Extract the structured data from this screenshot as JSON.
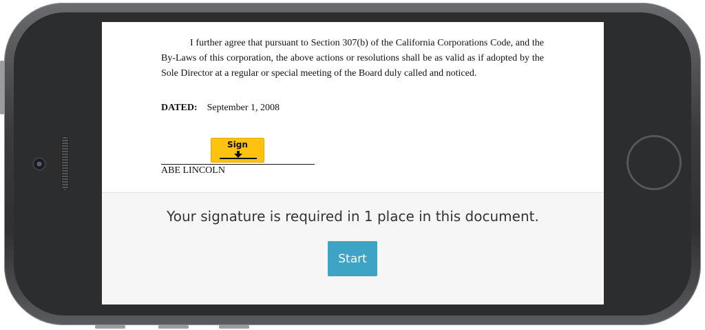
{
  "document": {
    "paragraph": "I further agree that pursuant to Section 307(b) of the California Corporations Code, and the By-Laws of this corporation, the above actions or resolutions shall be as valid as if adopted by the Sole Director at a regular or special meeting of the Board duly called and noticed.",
    "dated_label": "DATED:",
    "dated_value": "September 1, 2008",
    "sign_label": "Sign",
    "sign_icon": "down-arrow-icon",
    "signer_name": "ABE LINCOLN"
  },
  "panel": {
    "message": "Your signature is required in 1 place in this document.",
    "start_label": "Start"
  },
  "colors": {
    "sign_button": "#ffc20e",
    "start_button": "#3ea4c6",
    "panel_bg": "#f6f6f6"
  }
}
